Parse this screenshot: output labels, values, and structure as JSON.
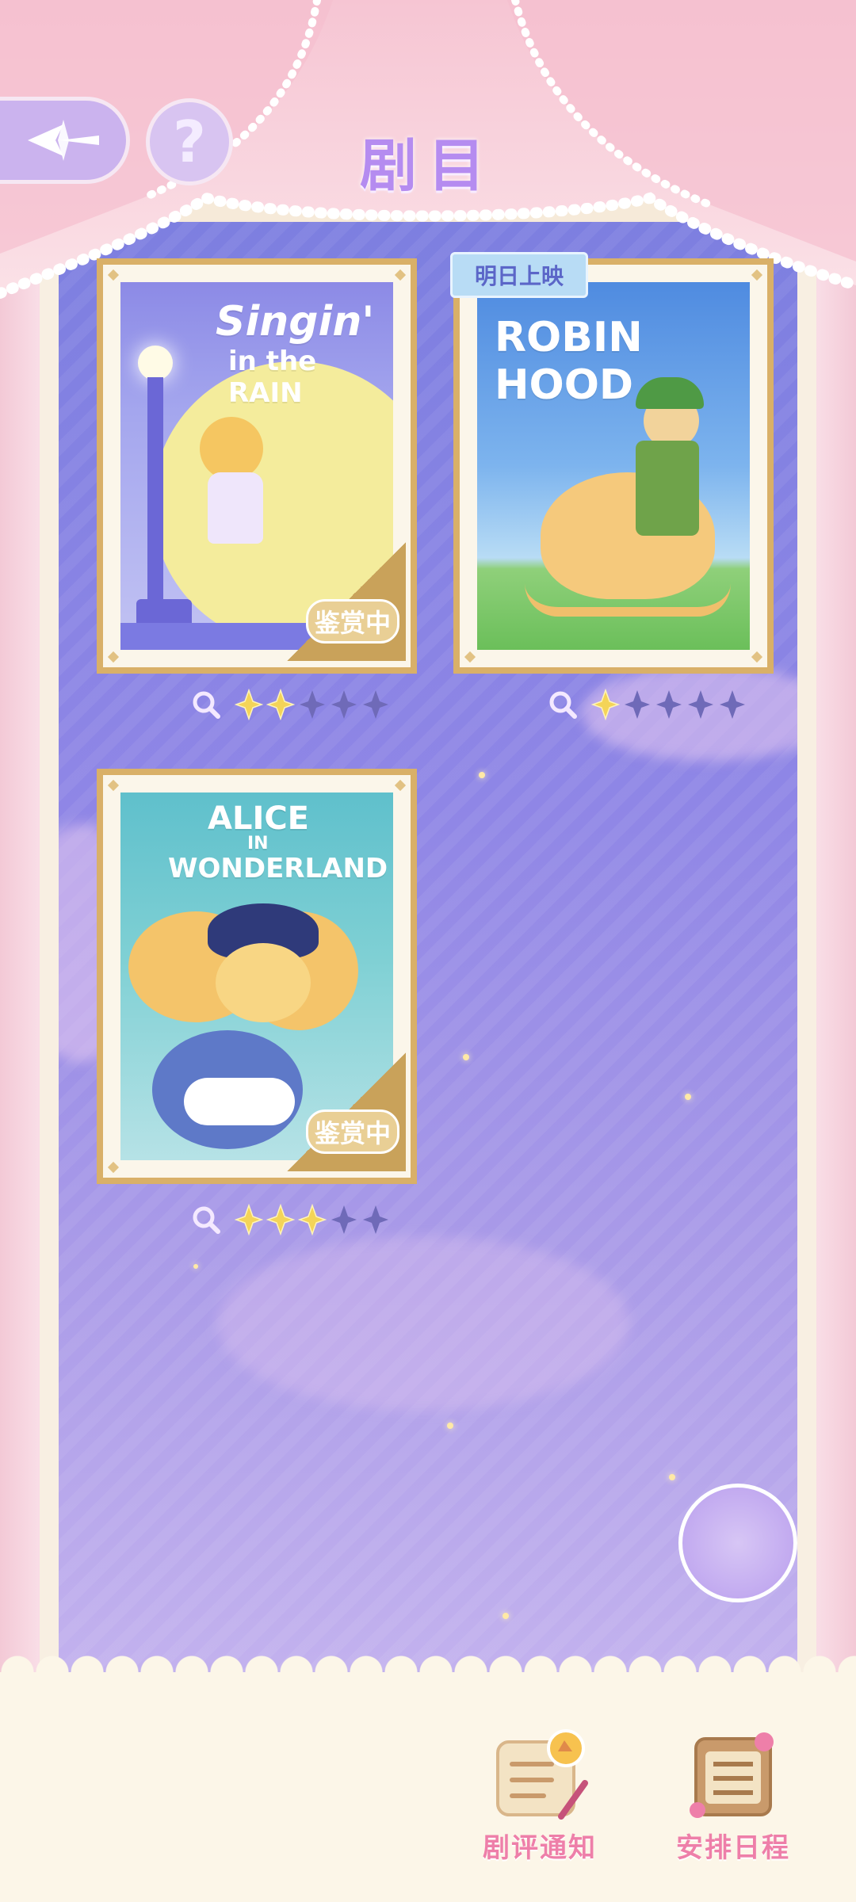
{
  "header": {
    "title": "剧目",
    "help_symbol": "?"
  },
  "posters": [
    {
      "title_line1": "Singin'",
      "title_line2": "in the RAIN",
      "status": "鉴赏中",
      "rating": 2,
      "max_rating": 5
    },
    {
      "title_line1": "ROBIN",
      "title_line2": "HOOD",
      "badge": "明日上映",
      "rating": 1,
      "max_rating": 5
    },
    {
      "title_line1": "ALICE",
      "title_line2": "IN",
      "title_line3": "WONDERLAND",
      "status": "鉴赏中",
      "rating": 3,
      "max_rating": 5
    }
  ],
  "bottom_nav": {
    "review_label": "剧评通知",
    "schedule_label": "安排日程"
  },
  "colors": {
    "accent": "#b58cf0",
    "pink": "#ee7fa9",
    "gold": "#d9b068",
    "stage": "#8f86e6"
  },
  "icons": [
    "back-arrow-icon",
    "help-icon",
    "magnifier-icon",
    "star-icon",
    "review-scroll-icon",
    "schedule-board-icon"
  ]
}
